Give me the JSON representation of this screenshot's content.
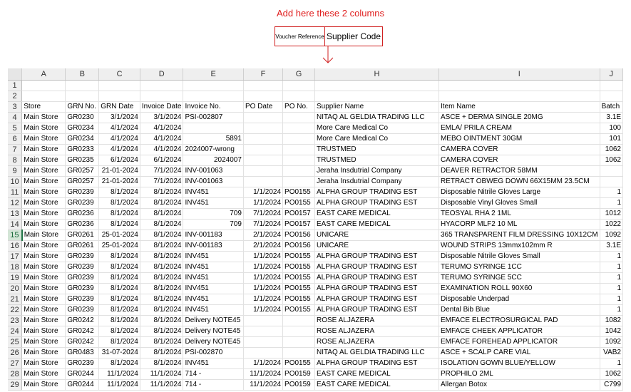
{
  "annotation": {
    "title": "Add here these 2 columns",
    "col1": "Voucher Reference",
    "col2": "Supplier Code"
  },
  "sheet": {
    "columns": [
      "A",
      "B",
      "C",
      "D",
      "E",
      "F",
      "G",
      "H",
      "I",
      "J"
    ],
    "row_numbers": [
      1,
      2,
      3,
      4,
      5,
      6,
      7,
      8,
      9,
      10,
      11,
      12,
      13,
      14,
      15,
      16,
      17,
      18,
      19,
      20,
      21,
      22,
      23,
      24,
      25,
      26,
      27,
      28,
      29
    ],
    "selected_row": 15,
    "headers": [
      "Store",
      "GRN No.",
      "GRN Date",
      "Invoice Date",
      "Invoice No.",
      "PO Date",
      "PO No.",
      "Supplier Name",
      "Item Name",
      "Batch"
    ],
    "rows": [
      [
        "Main Store",
        "GR0230",
        "3/1/2024",
        "3/1/2024",
        "PSI-002807",
        "",
        "",
        "NITAQ AL GELDIA TRADING LLC",
        "ASCE + DERMA SINGLE 20MG",
        "3.1E"
      ],
      [
        "Main Store",
        "GR0234",
        "4/1/2024",
        "4/1/2024",
        "",
        "",
        "",
        "More Care Medical Co",
        "EMLA/ PRILA CREAM",
        "100"
      ],
      [
        "Main Store",
        "GR0234",
        "4/1/2024",
        "4/1/2024",
        "5891",
        "",
        "",
        "More Care Medical Co",
        "MEBO OINTMENT 30GM",
        "101"
      ],
      [
        "Main Store",
        "GR0233",
        "4/1/2024",
        "4/1/2024",
        "2024007-wrong",
        "",
        "",
        "TRUSTMED",
        "CAMERA COVER",
        "1062"
      ],
      [
        "Main Store",
        "GR0235",
        "6/1/2024",
        "6/1/2024",
        "2024007",
        "",
        "",
        "TRUSTMED",
        "CAMERA COVER",
        "1062"
      ],
      [
        "Main Store",
        "GR0257",
        "21-01-2024",
        "7/1/2024",
        "INV-001063",
        "",
        "",
        "Jeraha Insdutrial Company",
        "DEAVER RETRACTOR 58MM",
        ""
      ],
      [
        "Main Store",
        "GR0257",
        "21-01-2024",
        "7/1/2024",
        "INV-001063",
        "",
        "",
        "Jeraha Insdutrial Company",
        "RETRACT OBWEG DOWN 66X15MM 23.5CM",
        ""
      ],
      [
        "Main Store",
        "GR0239",
        "8/1/2024",
        "8/1/2024",
        "INV451",
        "1/1/2024",
        "PO0155",
        "ALPHA GROUP TRADING EST",
        "Disposable Nitrile Gloves Large",
        "1"
      ],
      [
        "Main Store",
        "GR0239",
        "8/1/2024",
        "8/1/2024",
        "INV451",
        "1/1/2024",
        "PO0155",
        "ALPHA GROUP TRADING EST",
        "Disposable Vinyl Gloves Small",
        "1"
      ],
      [
        "Main Store",
        "GR0236",
        "8/1/2024",
        "8/1/2024",
        "709",
        "7/1/2024",
        "PO0157",
        "EAST CARE MEDICAL",
        "TEOSYAL RHA 2 1ML",
        "1012"
      ],
      [
        "Main Store",
        "GR0236",
        "8/1/2024",
        "8/1/2024",
        "709",
        "7/1/2024",
        "PO0157",
        "EAST CARE MEDICAL",
        "HYACORP MLF2 10 ML",
        "1022"
      ],
      [
        "Main Store",
        "GR0261",
        "25-01-2024",
        "8/1/2024",
        "INV-001183",
        "2/1/2024",
        "PO0156",
        "UNICARE",
        "365 TRANSPARENT FILM DRESSING 10X12CM",
        "1092"
      ],
      [
        "Main Store",
        "GR0261",
        "25-01-2024",
        "8/1/2024",
        "INV-001183",
        "2/1/2024",
        "PO0156",
        "UNICARE",
        "WOUND STRIPS 13mmx102mm R",
        "3.1E"
      ],
      [
        "Main Store",
        "GR0239",
        "8/1/2024",
        "8/1/2024",
        "INV451",
        "1/1/2024",
        "PO0155",
        "ALPHA GROUP TRADING EST",
        "Disposable Nitrile Gloves Small",
        "1"
      ],
      [
        "Main Store",
        "GR0239",
        "8/1/2024",
        "8/1/2024",
        "INV451",
        "1/1/2024",
        "PO0155",
        "ALPHA GROUP TRADING EST",
        "TERUMO SYRINGE 1CC",
        "1"
      ],
      [
        "Main Store",
        "GR0239",
        "8/1/2024",
        "8/1/2024",
        "INV451",
        "1/1/2024",
        "PO0155",
        "ALPHA GROUP TRADING EST",
        "TERUMO SYRINGE 5CC",
        "1"
      ],
      [
        "Main Store",
        "GR0239",
        "8/1/2024",
        "8/1/2024",
        "INV451",
        "1/1/2024",
        "PO0155",
        "ALPHA GROUP TRADING EST",
        "EXAMINATION ROLL 90X60",
        "1"
      ],
      [
        "Main Store",
        "GR0239",
        "8/1/2024",
        "8/1/2024",
        "INV451",
        "1/1/2024",
        "PO0155",
        "ALPHA GROUP TRADING EST",
        "Disposable Underpad",
        "1"
      ],
      [
        "Main Store",
        "GR0239",
        "8/1/2024",
        "8/1/2024",
        "INV451",
        "1/1/2024",
        "PO0155",
        "ALPHA GROUP TRADING EST",
        "Dental Bib Blue",
        "1"
      ],
      [
        "Main Store",
        "GR0242",
        "8/1/2024",
        "8/1/2024",
        "Delivery NOTE45",
        "",
        "",
        "ROSE ALJAZERA",
        "EMFACE ELECTROSURGICAL PAD",
        "1082"
      ],
      [
        "Main Store",
        "GR0242",
        "8/1/2024",
        "8/1/2024",
        "Delivery NOTE45",
        "",
        "",
        "ROSE ALJAZERA",
        "EMFACE CHEEK APPLICATOR",
        "1042"
      ],
      [
        "Main Store",
        "GR0242",
        "8/1/2024",
        "8/1/2024",
        "Delivery NOTE45",
        "",
        "",
        "ROSE ALJAZERA",
        "EMFACE FOREHEAD APPLICATOR",
        "1092"
      ],
      [
        "Main Store",
        "GR0483",
        "31-07-2024",
        "8/1/2024",
        "PSI-002870",
        "",
        "",
        "NITAQ AL GELDIA TRADING LLC",
        "ASCE + SCALP CARE VIAL",
        "VAB2"
      ],
      [
        "Main Store",
        "GR0239",
        "8/1/2024",
        "8/1/2024",
        "INV451",
        "1/1/2024",
        "PO0155",
        "ALPHA GROUP TRADING EST",
        "ISOLATION GOWN BLUE/YELLOW",
        "1"
      ],
      [
        "Main Store",
        "GR0244",
        "11/1/2024",
        "11/1/2024",
        "714 -",
        "11/1/2024",
        "PO0159",
        "EAST CARE MEDICAL",
        "PROPHILO 2ML",
        "1062"
      ],
      [
        "Main Store",
        "GR0244",
        "11/1/2024",
        "11/1/2024",
        "714 -",
        "11/1/2024",
        "PO0159",
        "EAST CARE MEDICAL",
        "Allergan Botox",
        "C799"
      ]
    ]
  }
}
